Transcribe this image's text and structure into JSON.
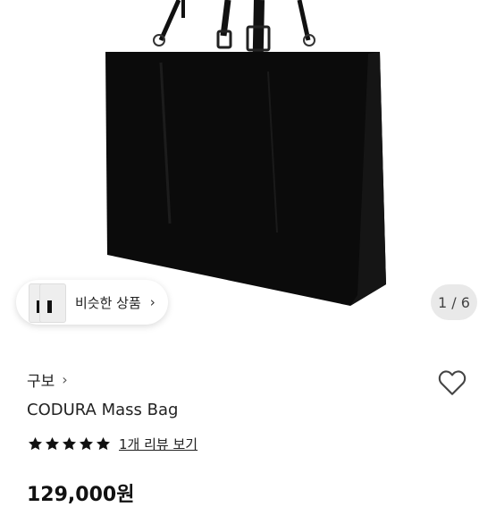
{
  "similar": {
    "label": "비슷한 상품"
  },
  "counter": {
    "text": "1 / 6"
  },
  "product": {
    "brand": "구보",
    "title": "CODURA Mass Bag",
    "rating": 5,
    "review_link": "1개 리뷰 보기",
    "price": "129,000원"
  },
  "icons": {
    "heart": "heart-icon",
    "star": "star-icon",
    "chevron": "chevron-right-icon"
  },
  "colors": {
    "bag": "#0b0b0b",
    "background": "#ffffff"
  }
}
